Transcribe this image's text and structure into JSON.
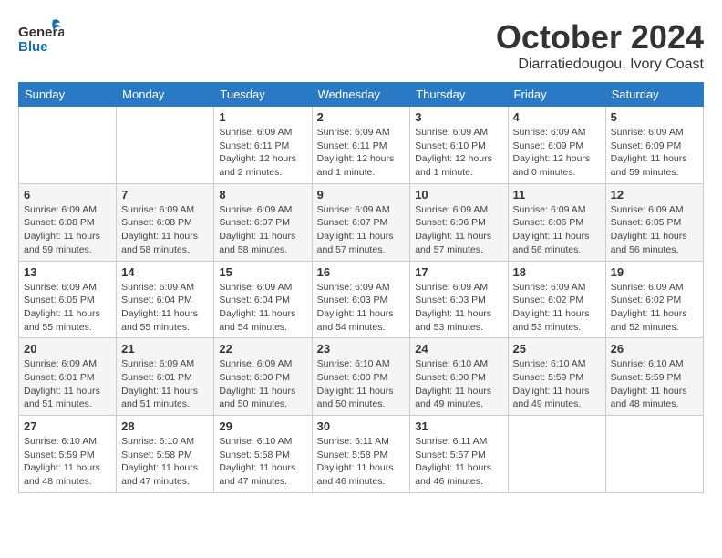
{
  "header": {
    "logo_general": "General",
    "logo_blue": "Blue",
    "month_title": "October 2024",
    "location": "Diarratiedougou, Ivory Coast"
  },
  "weekdays": [
    "Sunday",
    "Monday",
    "Tuesday",
    "Wednesday",
    "Thursday",
    "Friday",
    "Saturday"
  ],
  "weeks": [
    [
      {
        "day": "",
        "info": ""
      },
      {
        "day": "",
        "info": ""
      },
      {
        "day": "1",
        "info": "Sunrise: 6:09 AM\nSunset: 6:11 PM\nDaylight: 12 hours\nand 2 minutes."
      },
      {
        "day": "2",
        "info": "Sunrise: 6:09 AM\nSunset: 6:11 PM\nDaylight: 12 hours\nand 1 minute."
      },
      {
        "day": "3",
        "info": "Sunrise: 6:09 AM\nSunset: 6:10 PM\nDaylight: 12 hours\nand 1 minute."
      },
      {
        "day": "4",
        "info": "Sunrise: 6:09 AM\nSunset: 6:09 PM\nDaylight: 12 hours\nand 0 minutes."
      },
      {
        "day": "5",
        "info": "Sunrise: 6:09 AM\nSunset: 6:09 PM\nDaylight: 11 hours\nand 59 minutes."
      }
    ],
    [
      {
        "day": "6",
        "info": "Sunrise: 6:09 AM\nSunset: 6:08 PM\nDaylight: 11 hours\nand 59 minutes."
      },
      {
        "day": "7",
        "info": "Sunrise: 6:09 AM\nSunset: 6:08 PM\nDaylight: 11 hours\nand 58 minutes."
      },
      {
        "day": "8",
        "info": "Sunrise: 6:09 AM\nSunset: 6:07 PM\nDaylight: 11 hours\nand 58 minutes."
      },
      {
        "day": "9",
        "info": "Sunrise: 6:09 AM\nSunset: 6:07 PM\nDaylight: 11 hours\nand 57 minutes."
      },
      {
        "day": "10",
        "info": "Sunrise: 6:09 AM\nSunset: 6:06 PM\nDaylight: 11 hours\nand 57 minutes."
      },
      {
        "day": "11",
        "info": "Sunrise: 6:09 AM\nSunset: 6:06 PM\nDaylight: 11 hours\nand 56 minutes."
      },
      {
        "day": "12",
        "info": "Sunrise: 6:09 AM\nSunset: 6:05 PM\nDaylight: 11 hours\nand 56 minutes."
      }
    ],
    [
      {
        "day": "13",
        "info": "Sunrise: 6:09 AM\nSunset: 6:05 PM\nDaylight: 11 hours\nand 55 minutes."
      },
      {
        "day": "14",
        "info": "Sunrise: 6:09 AM\nSunset: 6:04 PM\nDaylight: 11 hours\nand 55 minutes."
      },
      {
        "day": "15",
        "info": "Sunrise: 6:09 AM\nSunset: 6:04 PM\nDaylight: 11 hours\nand 54 minutes."
      },
      {
        "day": "16",
        "info": "Sunrise: 6:09 AM\nSunset: 6:03 PM\nDaylight: 11 hours\nand 54 minutes."
      },
      {
        "day": "17",
        "info": "Sunrise: 6:09 AM\nSunset: 6:03 PM\nDaylight: 11 hours\nand 53 minutes."
      },
      {
        "day": "18",
        "info": "Sunrise: 6:09 AM\nSunset: 6:02 PM\nDaylight: 11 hours\nand 53 minutes."
      },
      {
        "day": "19",
        "info": "Sunrise: 6:09 AM\nSunset: 6:02 PM\nDaylight: 11 hours\nand 52 minutes."
      }
    ],
    [
      {
        "day": "20",
        "info": "Sunrise: 6:09 AM\nSunset: 6:01 PM\nDaylight: 11 hours\nand 51 minutes."
      },
      {
        "day": "21",
        "info": "Sunrise: 6:09 AM\nSunset: 6:01 PM\nDaylight: 11 hours\nand 51 minutes."
      },
      {
        "day": "22",
        "info": "Sunrise: 6:09 AM\nSunset: 6:00 PM\nDaylight: 11 hours\nand 50 minutes."
      },
      {
        "day": "23",
        "info": "Sunrise: 6:10 AM\nSunset: 6:00 PM\nDaylight: 11 hours\nand 50 minutes."
      },
      {
        "day": "24",
        "info": "Sunrise: 6:10 AM\nSunset: 6:00 PM\nDaylight: 11 hours\nand 49 minutes."
      },
      {
        "day": "25",
        "info": "Sunrise: 6:10 AM\nSunset: 5:59 PM\nDaylight: 11 hours\nand 49 minutes."
      },
      {
        "day": "26",
        "info": "Sunrise: 6:10 AM\nSunset: 5:59 PM\nDaylight: 11 hours\nand 48 minutes."
      }
    ],
    [
      {
        "day": "27",
        "info": "Sunrise: 6:10 AM\nSunset: 5:59 PM\nDaylight: 11 hours\nand 48 minutes."
      },
      {
        "day": "28",
        "info": "Sunrise: 6:10 AM\nSunset: 5:58 PM\nDaylight: 11 hours\nand 47 minutes."
      },
      {
        "day": "29",
        "info": "Sunrise: 6:10 AM\nSunset: 5:58 PM\nDaylight: 11 hours\nand 47 minutes."
      },
      {
        "day": "30",
        "info": "Sunrise: 6:11 AM\nSunset: 5:58 PM\nDaylight: 11 hours\nand 46 minutes."
      },
      {
        "day": "31",
        "info": "Sunrise: 6:11 AM\nSunset: 5:57 PM\nDaylight: 11 hours\nand 46 minutes."
      },
      {
        "day": "",
        "info": ""
      },
      {
        "day": "",
        "info": ""
      }
    ]
  ]
}
